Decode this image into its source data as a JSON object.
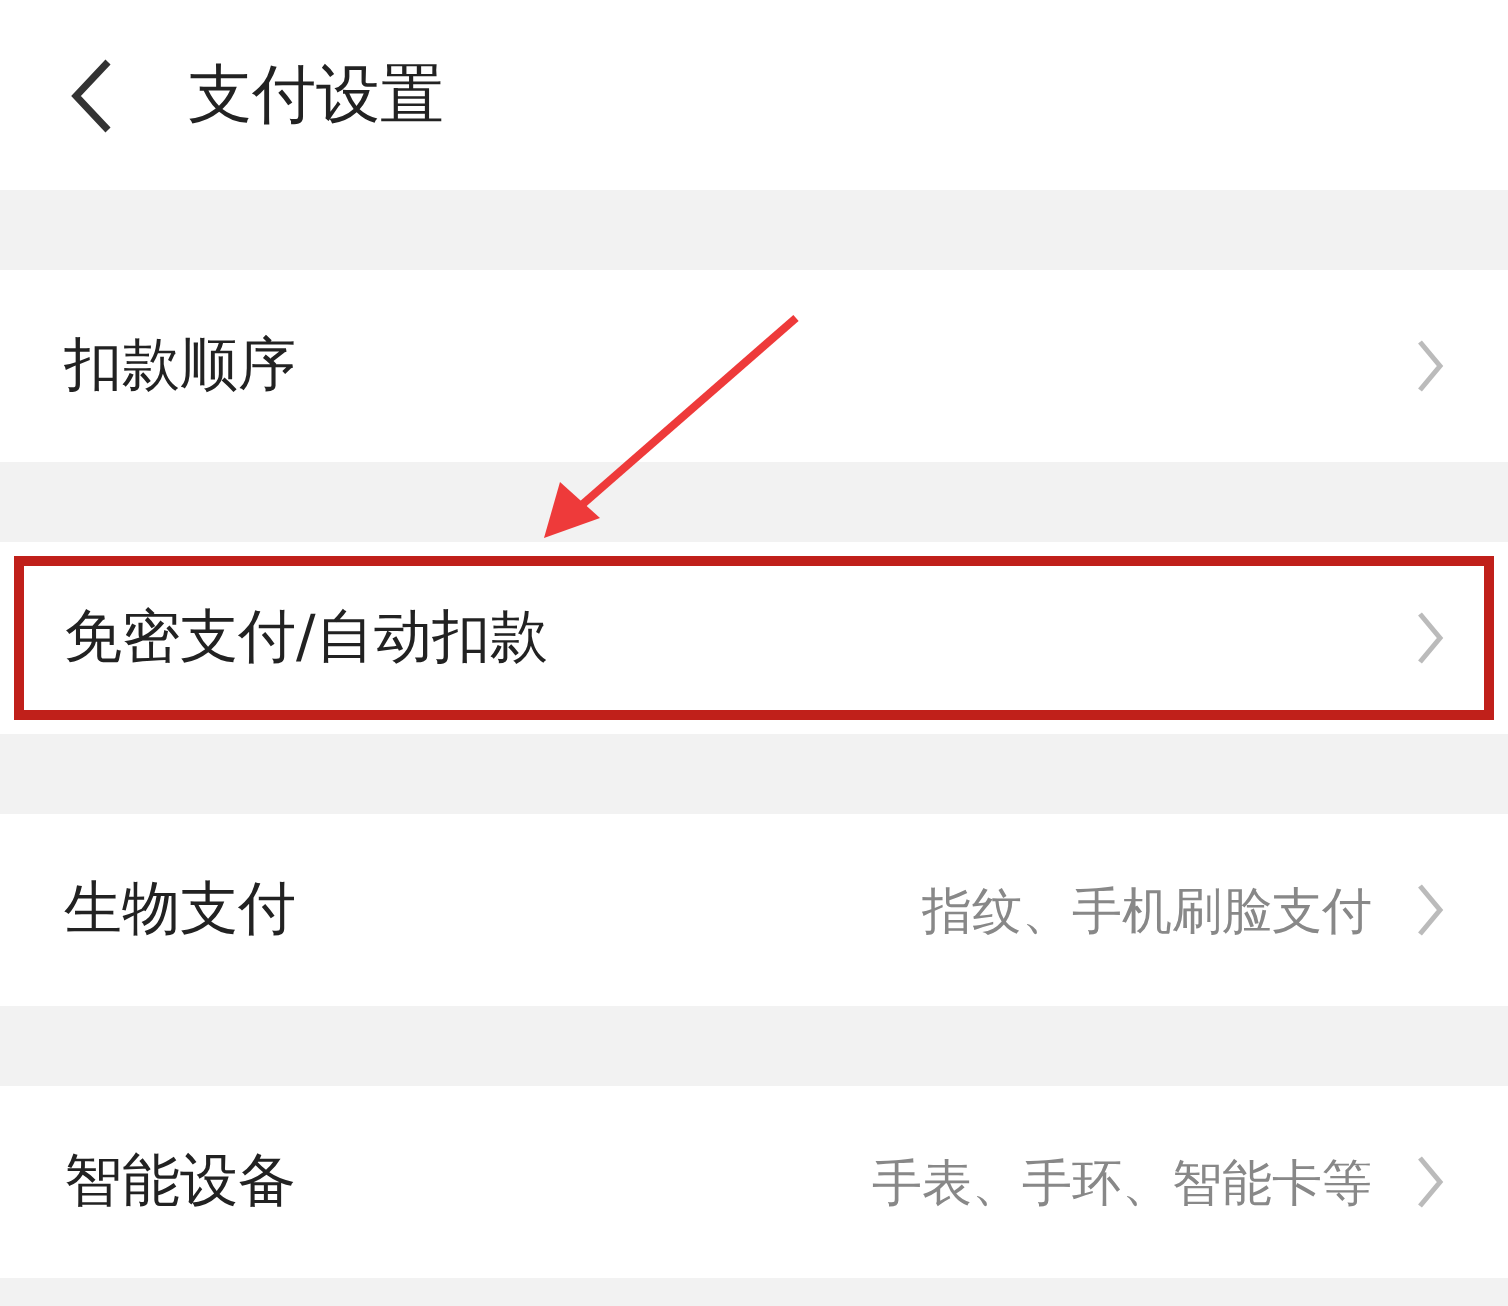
{
  "header": {
    "title": "支付设置"
  },
  "rows": [
    {
      "label": "扣款顺序",
      "value": null,
      "highlighted": false
    },
    {
      "label": "免密支付/自动扣款",
      "value": null,
      "highlighted": true
    },
    {
      "label": "生物支付",
      "value": "指纹、手机刷脸支付",
      "highlighted": false
    },
    {
      "label": "智能设备",
      "value": "手表、手环、智能卡等",
      "highlighted": false
    }
  ]
}
